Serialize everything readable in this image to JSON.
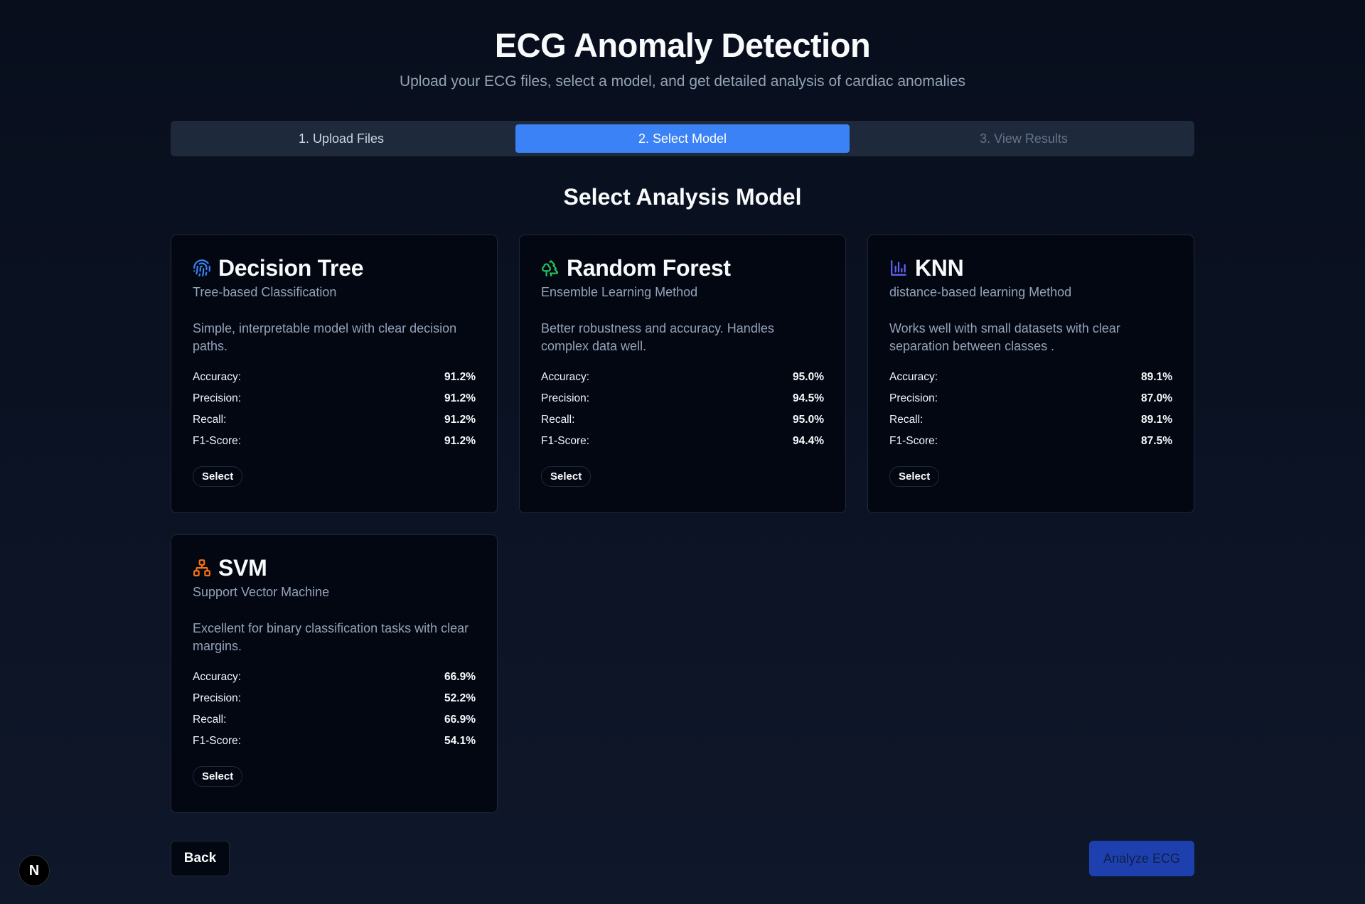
{
  "header": {
    "title": "ECG Anomaly Detection",
    "subtitle": "Upload your ECG files, select a model, and get detailed analysis of cardiac anomalies"
  },
  "stepper": {
    "steps": [
      {
        "label": "1. Upload Files",
        "state": "completed"
      },
      {
        "label": "2. Select Model",
        "state": "active"
      },
      {
        "label": "3. View Results",
        "state": "disabled"
      }
    ]
  },
  "section_title": "Select Analysis Model",
  "metric_labels": {
    "accuracy": "Accuracy:",
    "precision": "Precision:",
    "recall": "Recall:",
    "f1": "F1-Score:"
  },
  "models": [
    {
      "name": "Decision Tree",
      "subtitle": "Tree-based Classification",
      "description": "Simple, interpretable model with clear decision paths.",
      "icon": "fingerprint-icon",
      "icon_color": "#3b82f6",
      "accuracy": "91.2%",
      "precision": "91.2%",
      "recall": "91.2%",
      "f1": "91.2%",
      "select_label": "Select"
    },
    {
      "name": "Random Forest",
      "subtitle": "Ensemble Learning Method",
      "description": "Better robustness and accuracy. Handles complex data well.",
      "icon": "trees-icon",
      "icon_color": "#22c55e",
      "accuracy": "95.0%",
      "precision": "94.5%",
      "recall": "95.0%",
      "f1": "94.4%",
      "select_label": "Select"
    },
    {
      "name": "KNN",
      "subtitle": "distance-based learning Method",
      "description": "Works well with small datasets with clear separation between classes .",
      "icon": "bar-chart-icon",
      "icon_color": "#6366f1",
      "accuracy": "89.1%",
      "precision": "87.0%",
      "recall": "89.1%",
      "f1": "87.5%",
      "select_label": "Select"
    },
    {
      "name": "SVM",
      "subtitle": "Support Vector Machine",
      "description": "Excellent for binary classification tasks with clear margins.",
      "icon": "network-icon",
      "icon_color": "#f97316",
      "accuracy": "66.9%",
      "precision": "52.2%",
      "recall": "66.9%",
      "f1": "54.1%",
      "select_label": "Select"
    }
  ],
  "footer": {
    "back_label": "Back",
    "analyze_label": "Analyze ECG",
    "badge_label": "N"
  }
}
